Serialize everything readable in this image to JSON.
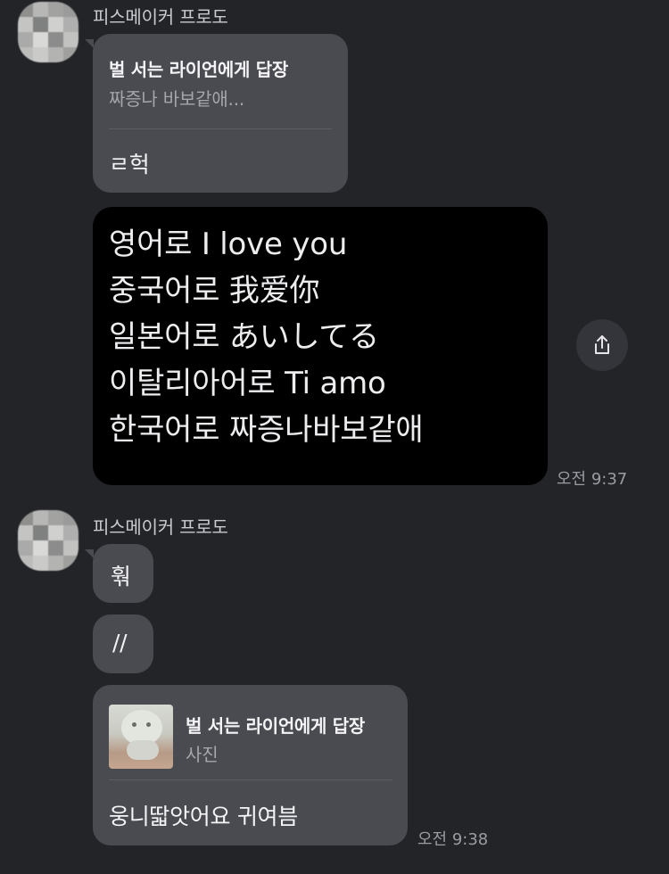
{
  "colors": {
    "background": "#232428",
    "bubble": "#4a4b51",
    "image_bg": "#000000",
    "text_primary": "#f4f4f6",
    "text_secondary": "#a5a6ad"
  },
  "messages": {
    "group1": {
      "sender": "피스메이커 프로도",
      "reply_bubble": {
        "reply_title": "벌 서는 라이언에게 답장",
        "reply_quote": "짜증나 바보같애...",
        "text": "ㄹ헉"
      },
      "image_message": {
        "lines": [
          "영어로 I love you",
          "중국어로 我爱你",
          "일본어로 あいしてる",
          "이탈리아어로 Ti amo",
          "한국어로 짜증나바보같애"
        ],
        "share_icon": "share-icon",
        "time": "오전 9:37"
      }
    },
    "group2": {
      "sender": "피스메이커 프로도",
      "bubble1": "훢",
      "bubble2": "//",
      "reply_bubble": {
        "reply_title": "벌 서는 라이언에게 답장",
        "reply_quote": "사진",
        "text": "웅니딻앗어요 귀여븜"
      },
      "time": "오전 9:38"
    }
  }
}
